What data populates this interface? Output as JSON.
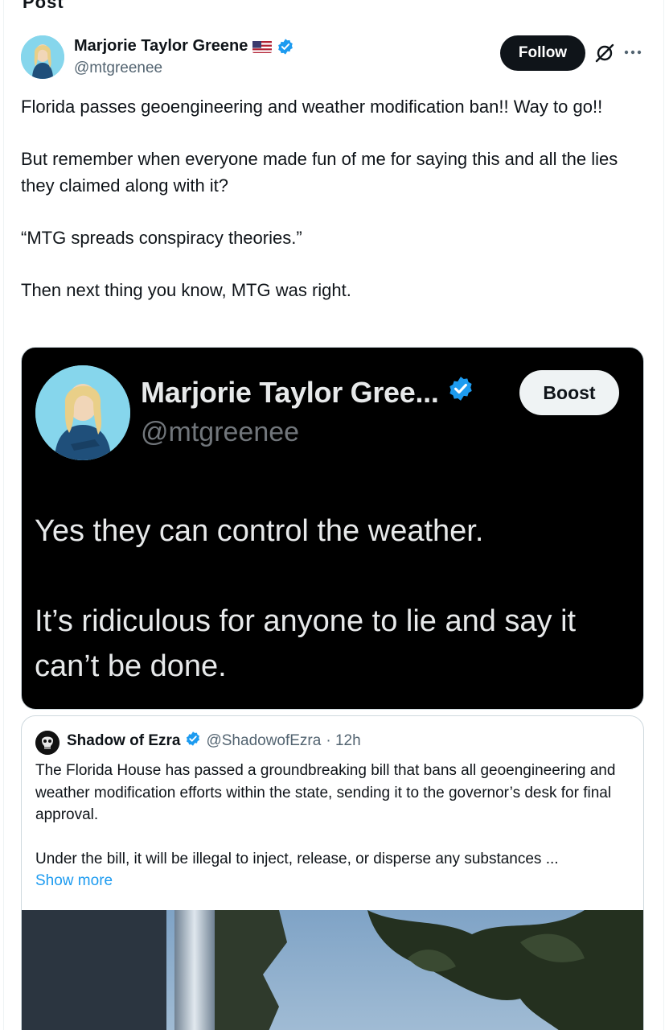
{
  "top_fragment": "Post",
  "author": {
    "name": "Marjorie Taylor Greene",
    "handle": "@mtgreenee",
    "flag_icon": "us-flag-icon",
    "verified_icon": "verified-badge-icon"
  },
  "actions": {
    "follow_label": "Follow",
    "grok_icon": "grok-icon",
    "more_icon": "more-icon"
  },
  "tweet": {
    "paragraphs": [
      "Florida passes geoengineering and weather modification ban!! Way to go!!",
      "But remember when everyone made fun of me for saying this and all the lies they claimed along with it?",
      "“MTG spreads conspiracy theories.”",
      "Then next thing you know, MTG was right."
    ]
  },
  "embedded_image": {
    "name": "Marjorie Taylor Gree...",
    "handle": "@mtgreenee",
    "boost_label": "Boost",
    "line1": "Yes they can control the weather.",
    "line2": "It’s ridiculous for anyone to lie and say it can’t be done."
  },
  "quote": {
    "name": "Shadow of Ezra",
    "handle": "@ShadowofEzra",
    "time": "· 12h",
    "paragraph1": "The Florida House has passed a groundbreaking bill that bans all geoengineering and weather modification efforts within the state, sending it to the governor’s desk for final approval.",
    "paragraph2": "Under the bill, it will be illegal to inject, release, or disperse any substances ...",
    "show_more": "Show more"
  },
  "colors": {
    "accent": "#1d9bf0",
    "text": "#0f1419",
    "secondary": "#536471",
    "dark_bg": "#000000"
  }
}
